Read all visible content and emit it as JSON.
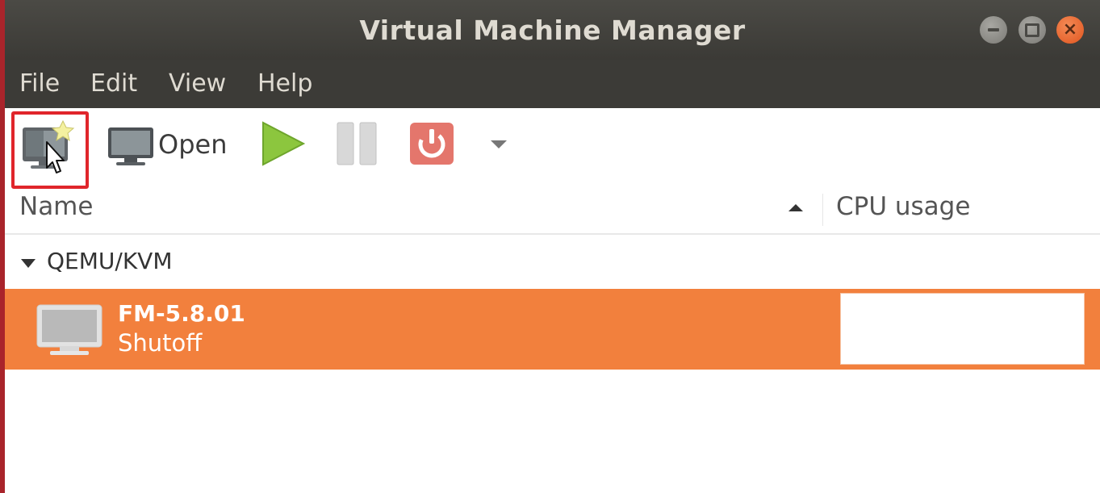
{
  "window": {
    "title": "Virtual Machine Manager"
  },
  "menu": {
    "items": [
      "File",
      "Edit",
      "View",
      "Help"
    ]
  },
  "toolbar": {
    "new_vm_icon": "new-vm-icon",
    "open_label": "Open",
    "run_icon": "play-icon",
    "pause_icon": "pause-icon",
    "shutdown_icon": "power-icon",
    "dropdown_icon": "chevron-down-icon"
  },
  "columns": {
    "name": "Name",
    "cpu": "CPU usage"
  },
  "tree": {
    "group": "QEMU/KVM",
    "vms": [
      {
        "name": "FM-5.8.01",
        "state": "Shutoff"
      }
    ]
  },
  "colors": {
    "accent": "#f2803d",
    "titlebar": "#3c3b37",
    "close": "#e0551f"
  }
}
